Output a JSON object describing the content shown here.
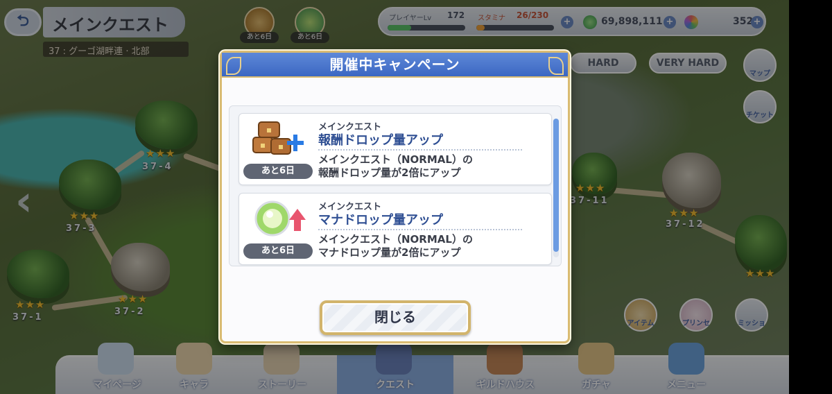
{
  "header": {
    "title": "メインクエスト",
    "subtitle": "37 : グーゴ湖畔連 · 北部",
    "top_icons": [
      {
        "name": "bonus-chest-icon",
        "caption": "あと6日"
      },
      {
        "name": "mana-orb-icon",
        "caption": "あと6日"
      }
    ]
  },
  "status": {
    "player_level_label": "プレイヤーLv",
    "player_level": "172",
    "player_exp_fraction": 0.3,
    "stamina_label": "スタミナ",
    "stamina": "26/230",
    "stamina_fraction": 0.11,
    "mana": "69,898,111",
    "jewels": "352"
  },
  "difficulty": {
    "hard": "HARD",
    "very_hard": "VERY HARD"
  },
  "side_buttons": {
    "map": "マップ",
    "ticket": "チケット"
  },
  "map_nodes": [
    {
      "label": "37-4"
    },
    {
      "label": "37-3"
    },
    {
      "label": "37-1"
    },
    {
      "label": "37-2"
    },
    {
      "label": "37-11"
    },
    {
      "label": "37-12"
    }
  ],
  "right_icons": {
    "item": "アイテム",
    "pudding": "プリンセス",
    "mission": "ミッション"
  },
  "bottom_nav": [
    {
      "label": "マイページ"
    },
    {
      "label": "キャラ"
    },
    {
      "label": "ストーリー"
    },
    {
      "label": "クエスト"
    },
    {
      "label": "ギルドハウス"
    },
    {
      "label": "ガチャ"
    },
    {
      "label": "メニュー"
    }
  ],
  "modal": {
    "title": "開催中キャンペーン",
    "campaigns": [
      {
        "category": "メインクエスト",
        "title": "報酬ドロップ量アップ",
        "desc_line1": "メインクエスト（NORMAL）の",
        "desc_line2": "報酬ドロップ量が2倍にアップ",
        "remaining": "あと6日",
        "icon": "treasure-chest-plus-icon"
      },
      {
        "category": "メインクエスト",
        "title": "マナドロップ量アップ",
        "desc_line1": "メインクエスト（NORMAL）の",
        "desc_line2": "マナドロップ量が2倍にアップ",
        "remaining": "あと6日",
        "icon": "mana-orb-up-icon"
      }
    ],
    "close_label": "閉じる"
  },
  "colors": {
    "modal_header": "#3b67c2",
    "modal_border": "#d9bb72",
    "campaign_title": "#2f4f93",
    "scroll_thumb": "#6b9be2"
  }
}
